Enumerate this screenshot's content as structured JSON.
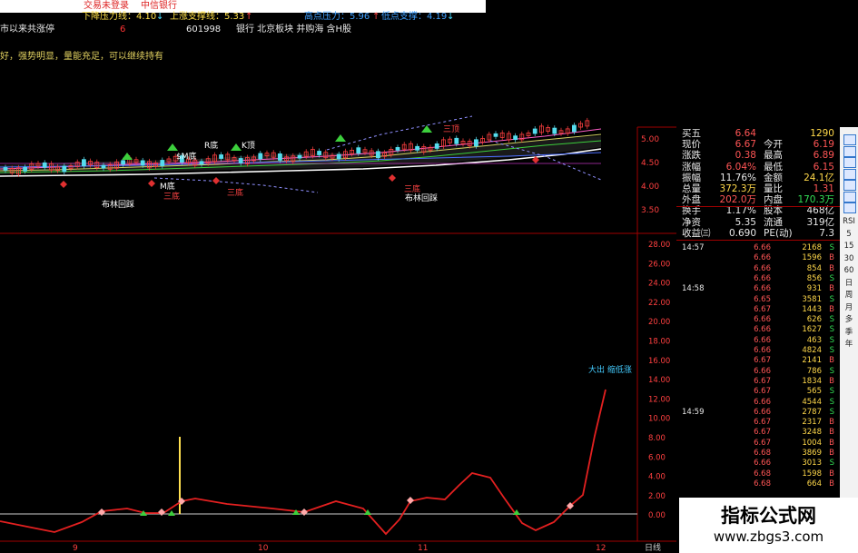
{
  "topbar": {
    "title": "交易未登录",
    "stock_name": "中信银行"
  },
  "header": {
    "line1": [
      {
        "text": "下降压力线：4.10",
        "color": "#ffe048"
      },
      {
        "text": "↓",
        "color": "#44ddff"
      },
      {
        "text": "上涨支撑线：5.33",
        "color": "#ffe048"
      },
      {
        "text": "↑",
        "color": "#ff4444"
      },
      {
        "text": "高点压力：5.96",
        "color": "#3fa0ff"
      },
      {
        "text": "↑",
        "color": "#ff4444"
      },
      {
        "text": "低点支撑：4.19",
        "color": "#3fa0ff"
      },
      {
        "text": "↓",
        "color": "#44ddff"
      }
    ],
    "line2": [
      {
        "text": "市以来共涨停",
        "color": "#e8e8e8"
      },
      {
        "text": "6",
        "color": "#ff3333"
      },
      {
        "text": "601998",
        "color": "#e8e8e8"
      },
      {
        "text": "银行 北京板块 并购海 含H股",
        "color": "#e8e8e8"
      }
    ],
    "line3": {
      "text": "好，强势明显，量能充足，可以继续持有",
      "color": "#e0d060"
    }
  },
  "price_axis": [
    "5.00",
    "4.50",
    "4.00",
    "3.50"
  ],
  "indicator_axis": [
    "28.00",
    "26.00",
    "24.00",
    "22.00",
    "20.00",
    "18.00",
    "16.00",
    "14.00",
    "12.00",
    "10.00",
    "8.00",
    "6.00",
    "4.00",
    "2.00",
    "0.00"
  ],
  "x_axis": {
    "labels": [
      "9",
      "10",
      "11",
      "12"
    ],
    "period": "日线"
  },
  "annotations": {
    "mdi": "$M底",
    "rdi": "R底",
    "kdi": "K顶",
    "mdi2": "M底",
    "sandi1": "三底",
    "sandi2": "三底",
    "sandi3": "三底",
    "sandi4": "三顶",
    "bolin1": "布林回踩",
    "bolin2": "布林回踩",
    "dachu": "大出 缩低涨"
  },
  "quote": {
    "rows": [
      {
        "l1": "买五",
        "v1": "6.64",
        "l2": "",
        "v2": "1290",
        "c1": "#ff5555",
        "c2": "#ffd84a"
      },
      {
        "l1": "现价",
        "v1": "6.67",
        "l2": "今开",
        "v2": "6.19",
        "c1": "#ff5555",
        "c2": "#ff5555"
      },
      {
        "l1": "涨跌",
        "v1": "0.38",
        "l2": "最高",
        "v2": "6.89",
        "c1": "#ff5555",
        "c2": "#ff5555"
      },
      {
        "l1": "涨幅",
        "v1": "6.04%",
        "l2": "最低",
        "v2": "6.15",
        "c1": "#ff5555",
        "c2": "#ff5555"
      },
      {
        "l1": "振幅",
        "v1": "11.76%",
        "l2": "金额",
        "v2": "24.1亿",
        "c1": "#e8e8e8",
        "c2": "#ffd84a"
      },
      {
        "l1": "总量",
        "v1": "372.3万",
        "l2": "量比",
        "v2": "1.31",
        "c1": "#ffd84a",
        "c2": "#ff5555"
      },
      {
        "l1": "外盘",
        "v1": "202.0万",
        "l2": "内盘",
        "v2": "170.3万",
        "c1": "#ff5555",
        "c2": "#33dd55"
      },
      {
        "l1": "换手",
        "v1": "1.17%",
        "l2": "股本",
        "v2": "468亿",
        "c1": "#e8e8e8",
        "c2": "#e8e8e8"
      },
      {
        "l1": "净资",
        "v1": "5.35",
        "l2": "流通",
        "v2": "319亿",
        "c1": "#e8e8e8",
        "c2": "#e8e8e8"
      },
      {
        "l1": "收益㈢",
        "v1": "0.690",
        "l2": "PE(动)",
        "v2": "7.3",
        "c1": "#e8e8e8",
        "c2": "#e8e8e8"
      }
    ]
  },
  "ticks": [
    {
      "time": "14:57",
      "price": "6.66",
      "vol": "2168",
      "side": "S"
    },
    {
      "time": "",
      "price": "6.66",
      "vol": "1596",
      "side": "B"
    },
    {
      "time": "",
      "price": "6.66",
      "vol": "854",
      "side": "B"
    },
    {
      "time": "",
      "price": "6.66",
      "vol": "856",
      "side": "S"
    },
    {
      "time": "14:58",
      "price": "6.66",
      "vol": "931",
      "side": "B"
    },
    {
      "time": "",
      "price": "6.65",
      "vol": "3581",
      "side": "S"
    },
    {
      "time": "",
      "price": "6.67",
      "vol": "1443",
      "side": "B"
    },
    {
      "time": "",
      "price": "6.66",
      "vol": "626",
      "side": "S"
    },
    {
      "time": "",
      "price": "6.66",
      "vol": "1627",
      "side": "S"
    },
    {
      "time": "",
      "price": "6.66",
      "vol": "463",
      "side": "S"
    },
    {
      "time": "",
      "price": "6.66",
      "vol": "4824",
      "side": "S"
    },
    {
      "time": "",
      "price": "6.67",
      "vol": "2141",
      "side": "B"
    },
    {
      "time": "",
      "price": "6.66",
      "vol": "786",
      "side": "S"
    },
    {
      "time": "",
      "price": "6.67",
      "vol": "1834",
      "side": "B"
    },
    {
      "time": "",
      "price": "6.67",
      "vol": "565",
      "side": "S"
    },
    {
      "time": "",
      "price": "6.66",
      "vol": "4544",
      "side": "S"
    },
    {
      "time": "14:59",
      "price": "6.66",
      "vol": "2787",
      "side": "S"
    },
    {
      "time": "",
      "price": "6.67",
      "vol": "2317",
      "side": "B"
    },
    {
      "time": "",
      "price": "6.67",
      "vol": "3248",
      "side": "B"
    },
    {
      "time": "",
      "price": "6.67",
      "vol": "1004",
      "side": "B"
    },
    {
      "time": "",
      "price": "6.68",
      "vol": "3869",
      "side": "B"
    },
    {
      "time": "",
      "price": "6.66",
      "vol": "3013",
      "side": "S"
    },
    {
      "time": "",
      "price": "6.68",
      "vol": "1598",
      "side": "B"
    },
    {
      "time": "",
      "price": "6.68",
      "vol": "664",
      "side": "B"
    }
  ],
  "sidebar": [
    "RSI",
    "5",
    "15",
    "30",
    "60",
    "日",
    "周",
    "月",
    "多",
    "季",
    "年"
  ],
  "watermark": {
    "title": "指标公式网",
    "url": "www.zbgs3.com"
  },
  "colors": {
    "up": "#ff3333",
    "down": "#33dd55",
    "grid": "#8b0000",
    "indicator_line": "#e32020",
    "zero_line": "#cccccc",
    "marker": "#ffe050"
  }
}
